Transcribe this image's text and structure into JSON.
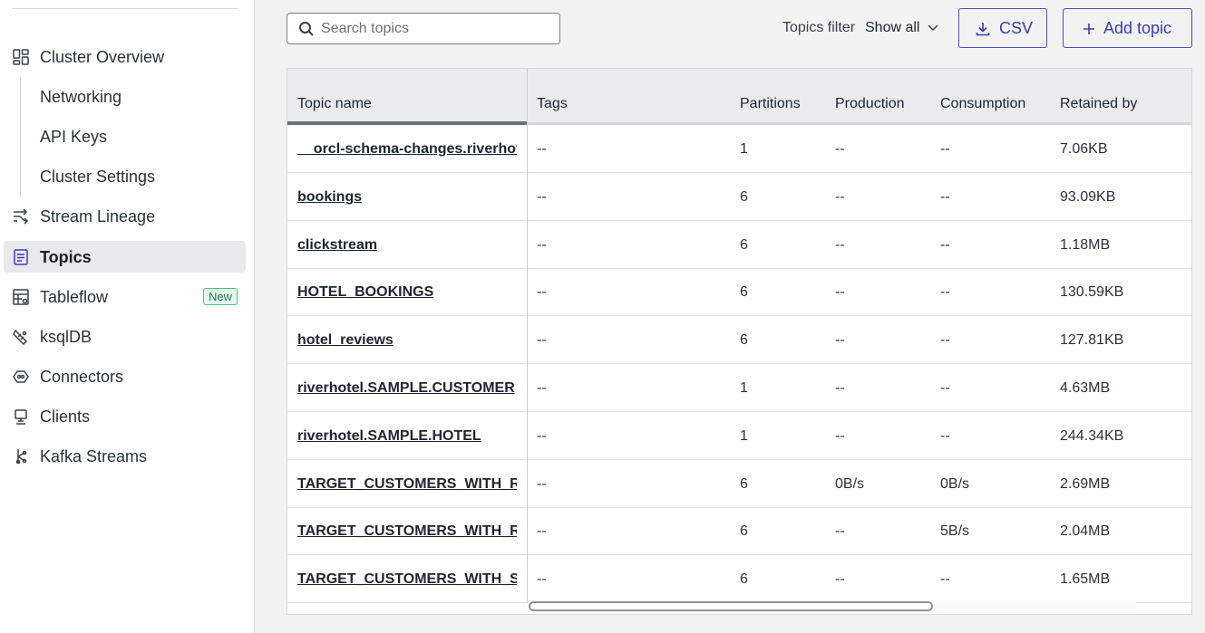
{
  "sidebar": {
    "items": [
      {
        "label": "Cluster Overview",
        "icon": "dashboard-icon"
      },
      {
        "label": "Networking",
        "icon": ""
      },
      {
        "label": "API Keys",
        "icon": ""
      },
      {
        "label": "Cluster Settings",
        "icon": ""
      },
      {
        "label": "Stream Lineage",
        "icon": "lineage-icon"
      },
      {
        "label": "Topics",
        "icon": "topics-icon",
        "active": true
      },
      {
        "label": "Tableflow",
        "icon": "tableflow-icon",
        "badge": "New"
      },
      {
        "label": "ksqlDB",
        "icon": "ksqldb-icon"
      },
      {
        "label": "Connectors",
        "icon": "connectors-icon"
      },
      {
        "label": "Clients",
        "icon": "clients-icon"
      },
      {
        "label": "Kafka Streams",
        "icon": "kafka-streams-icon"
      }
    ]
  },
  "toolbar": {
    "search_placeholder": "Search topics",
    "filter_label": "Topics filter",
    "filter_value": "Show all",
    "csv_label": "CSV",
    "add_label": "Add topic"
  },
  "colors": {
    "accent": "#3b3bb2",
    "active_bg": "#e9e9eb",
    "new_badge": "#4fbf83"
  },
  "table": {
    "headers": [
      "Topic name",
      "Tags",
      "Partitions",
      "Production",
      "Consumption",
      "Retained by"
    ],
    "rows": [
      {
        "name": "__orcl-schema-changes.riverhotel",
        "tags": "--",
        "partitions": "1",
        "production": "--",
        "consumption": "--",
        "retained": "7.06KB"
      },
      {
        "name": "bookings",
        "tags": "--",
        "partitions": "6",
        "production": "--",
        "consumption": "--",
        "retained": "93.09KB"
      },
      {
        "name": "clickstream",
        "tags": "--",
        "partitions": "6",
        "production": "--",
        "consumption": "--",
        "retained": "1.18MB"
      },
      {
        "name": "HOTEL_BOOKINGS",
        "tags": "--",
        "partitions": "6",
        "production": "--",
        "consumption": "--",
        "retained": "130.59KB"
      },
      {
        "name": "hotel_reviews",
        "tags": "--",
        "partitions": "6",
        "production": "--",
        "consumption": "--",
        "retained": "127.81KB"
      },
      {
        "name": "riverhotel.SAMPLE.CUSTOMER",
        "tags": "--",
        "partitions": "1",
        "production": "--",
        "consumption": "--",
        "retained": "4.63MB"
      },
      {
        "name": "riverhotel.SAMPLE.HOTEL",
        "tags": "--",
        "partitions": "1",
        "production": "--",
        "consumption": "--",
        "retained": "244.34KB"
      },
      {
        "name": "TARGET_CUSTOMERS_WITH_RE",
        "tags": "--",
        "partitions": "6",
        "production": "0B/s",
        "consumption": "0B/s",
        "retained": "2.69MB"
      },
      {
        "name": "TARGET_CUSTOMERS_WITH_RE",
        "tags": "--",
        "partitions": "6",
        "production": "--",
        "consumption": "5B/s",
        "retained": "2.04MB"
      },
      {
        "name": "TARGET_CUSTOMERS_WITH_SI",
        "tags": "--",
        "partitions": "6",
        "production": "--",
        "consumption": "--",
        "retained": "1.65MB"
      }
    ]
  }
}
